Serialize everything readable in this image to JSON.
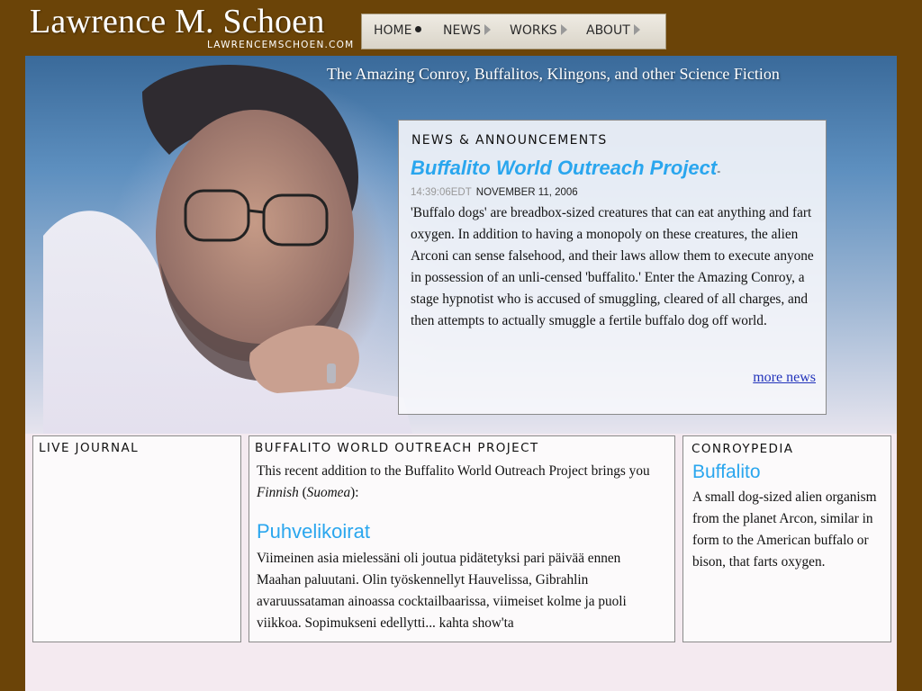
{
  "header": {
    "site_title": "Lawrence M. Schoen",
    "site_url": "LAWRENCEMSCHOEN.COM"
  },
  "nav": {
    "home": "HOME",
    "news": "NEWS",
    "works": "WORKS",
    "about": "ABOUT"
  },
  "hero": {
    "tagline": "The Amazing Conroy, Buffalitos, Klingons, and other Science Fiction"
  },
  "news_box": {
    "heading": "NEWS & ANNOUNCEMENTS",
    "title": "Buffalito World Outreach Project",
    "title_dash": "-",
    "time": "14:39:06EDT",
    "date": "NOVEMBER 11, 2006",
    "body": "'Buffalo dogs' are breadbox-sized creatures that can eat anything and fart oxygen. In addition to having a monopoly on these creatures, the alien Arconi can sense falsehood, and their laws allow them to execute anyone in possession of an unli-censed 'buffalito.' Enter the Amazing Conroy, a stage hypnotist who is accused of smuggling, cleared of all charges, and then attempts to actually smuggle a fertile buffalo dog off world.",
    "more_link": "more news"
  },
  "live_journal": {
    "heading": "LIVE JOURNAL"
  },
  "bwop": {
    "heading": "BUFFALITO WORLD OUTREACH PROJECT",
    "intro_a": "This recent addition to the Buffalito World Outreach Project brings you ",
    "intro_lang": "Finnish",
    "intro_b": " (",
    "intro_native": "Suomea",
    "intro_c": "):",
    "subtitle": "Puhvelikoirat",
    "body": "Viimeinen asia mielessäni oli joutua pidätetyksi pari päivää ennen Maahan paluutani. Olin työskennellyt Hauvelissa, Gibrahlin avaruussataman ainoassa cocktailbaarissa, viimeiset kolme ja puoli viikkoa. Sopimukseni edellytti... kahta show'ta"
  },
  "conroypedia": {
    "heading": "CONROYPEDIA",
    "term": "Buffalito",
    "definition": "A small dog-sized alien organism from the planet Arcon, similar in form to the American buffalo or bison, that farts oxygen."
  }
}
